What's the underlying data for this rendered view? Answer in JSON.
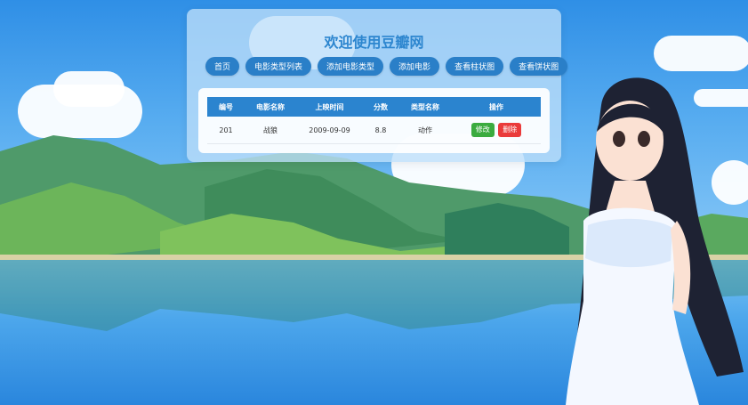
{
  "app": {
    "title": "欢迎使用豆瓣网"
  },
  "nav": {
    "items": [
      {
        "label": "首页"
      },
      {
        "label": "电影类型列表"
      },
      {
        "label": "添加电影类型"
      },
      {
        "label": "添加电影"
      },
      {
        "label": "查看柱状图"
      },
      {
        "label": "查看饼状图"
      }
    ]
  },
  "table": {
    "headers": [
      "编号",
      "电影名称",
      "上映时间",
      "分数",
      "类型名称",
      "操作"
    ],
    "rows": [
      {
        "id": "201",
        "name": "战狼",
        "date": "2009-09-09",
        "score": "8.8",
        "type": "动作",
        "edit_label": "修改",
        "delete_label": "删除"
      }
    ]
  },
  "colors": {
    "primary": "#2a7fc8",
    "title": "#2d86cf",
    "edit": "#3bab3f",
    "delete": "#ea3b3b"
  }
}
